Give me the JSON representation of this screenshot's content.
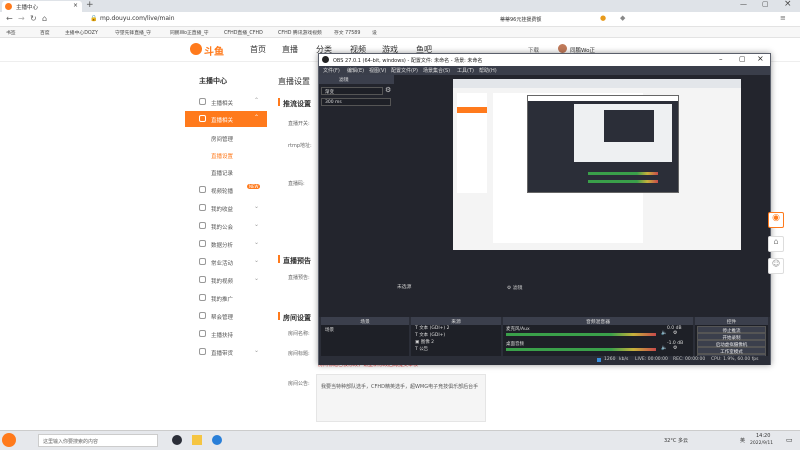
{
  "browser": {
    "tab_title": "主播中心",
    "address": "mp.douyu.com/live/main",
    "search_hint": "蒂蒂96元挂援费额",
    "bookmarks": [
      "书签",
      "百度",
      "主播中心DOZY",
      "守望先锋直播_守",
      "同鹏Wo正直播_守",
      "CFHD直播_CFHD",
      "CFHD 腾讯游戏视频",
      "存文 77589",
      "设"
    ]
  },
  "douyu": {
    "logo": "斗鱼",
    "nav": [
      "首页",
      "直播",
      "分类",
      "视频",
      "游戏",
      "鱼吧"
    ],
    "user": "同鹏Wo正",
    "download": "下载",
    "sidebar_title": "主播中心",
    "sidebar": [
      {
        "label": "主播相关",
        "expand": "^"
      },
      {
        "label": "直播相关",
        "expand": "^",
        "active": true
      },
      {
        "label": "房间管理"
      },
      {
        "label": "直播设置",
        "highlight": true
      },
      {
        "label": "直播记录"
      },
      {
        "label": "视频轮播",
        "badge": "NEW"
      },
      {
        "label": "我的收益",
        "expand": "v"
      },
      {
        "label": "我的公会",
        "expand": "v"
      },
      {
        "label": "数据分析",
        "expand": "v"
      },
      {
        "label": "常业活动",
        "expand": "v"
      },
      {
        "label": "我的视频",
        "expand": "v"
      },
      {
        "label": "我的推广"
      },
      {
        "label": "帮会管理"
      },
      {
        "label": "主播扶持"
      },
      {
        "label": "直播带货",
        "expand": "v"
      }
    ],
    "main_title": "直播设置",
    "section1": "推流设置",
    "rows1": [
      "直播开关:",
      "rtmp地址:",
      "直播码:"
    ],
    "section2": "直播预告",
    "row2": "直播预告:",
    "section3": "房间设置",
    "rows3": [
      "房间名称:",
      "房间标题:",
      "房间公告:"
    ],
    "notice_red": "房间标题已被修改，请重新修改后再提交审核",
    "notice_body": "我要当特种部队选手，CFHD精英选手，超WMG电子竞技俱乐部后台手"
  },
  "obs": {
    "title": "OBS 27.0.1 (64-bit, windows) - 配置文件: 未命名 - 场景: 未命名",
    "menu": [
      "文件(F)",
      "编辑(E)",
      "视图(V)",
      "配置文件(P)",
      "场景集合(S)",
      "工具(T)",
      "帮助(H)"
    ],
    "filter_label": "滤镜",
    "delay_label": "渐变",
    "delay_value": "300 ms",
    "not_selected": "未选源",
    "dock_headers": [
      "场景",
      "来源",
      "音频混音器",
      "控件"
    ],
    "filter_tab": "滤镜",
    "scene": "场景",
    "sources": [
      "文本 (GDI+) 2",
      "文本 (GDI+)",
      "图像 2",
      "公告",
      "守望先锋",
      "图像",
      "显示器采集"
    ],
    "mixer": [
      {
        "name": "桌面音频",
        "level": "-1.0 dB"
      },
      {
        "name": "麦克风/Aux",
        "level": "0.0 dB"
      }
    ],
    "controls": [
      "停止推流",
      "开始录制",
      "启动虚拟摄像机",
      "工作室模式",
      "设置",
      "退出"
    ],
    "status": {
      "live": "LIVE: 00:00:00",
      "rec": "REC: 00:00:00",
      "cpu": "CPU: 1.9%, 60.00 fps",
      "bitrate": "1260",
      "kbps": "kb/s"
    }
  },
  "taskbar": {
    "search_placeholder": "这里输入你要搜索的内容",
    "temp": "32°C 多云",
    "lang": "英",
    "time": "14:20",
    "date": "2022/9/11"
  },
  "colors": {
    "accent": "#ff7a1c",
    "obs_bg": "#2b2e38"
  }
}
